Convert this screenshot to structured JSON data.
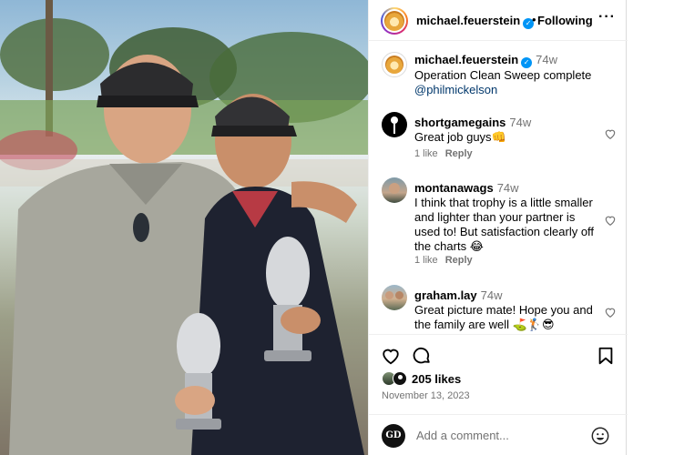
{
  "post": {
    "author": "michael.feuerstein",
    "follow_dot": "•",
    "follow_status": "Following",
    "more_glyph": "···",
    "verified_glyph": "✓"
  },
  "caption": {
    "username": "michael.feuerstein",
    "age": "74w",
    "text": "Operation Clean Sweep complete",
    "mention": "@philmickelson"
  },
  "comments": [
    {
      "username": "shortgamegains",
      "age": "74w",
      "text": "Great job guys👊",
      "likes": "1 like",
      "reply": "Reply"
    },
    {
      "username": "montanawags",
      "age": "74w",
      "text": "I think that trophy is a little smaller and lighter than your partner is used to! But satisfaction clearly off the charts 😂",
      "likes": "1 like",
      "reply": "Reply"
    },
    {
      "username": "graham.lay",
      "age": "74w",
      "text": "Great picture mate! Hope you and the family are well ⛳️🏌️😎"
    }
  ],
  "engagement": {
    "likes": "205 likes",
    "date": "November 13, 2023"
  },
  "composer": {
    "placeholder": "Add a comment...",
    "avatar_text": "GD"
  },
  "icons": {
    "like": "heart-icon",
    "comment": "comment-bubble-icon",
    "save": "bookmark-icon",
    "emoji": "emoji-icon",
    "comment_like": "heart-icon"
  },
  "colors": {
    "link": "#00376b",
    "verified": "#0095f6",
    "muted": "#737373"
  }
}
